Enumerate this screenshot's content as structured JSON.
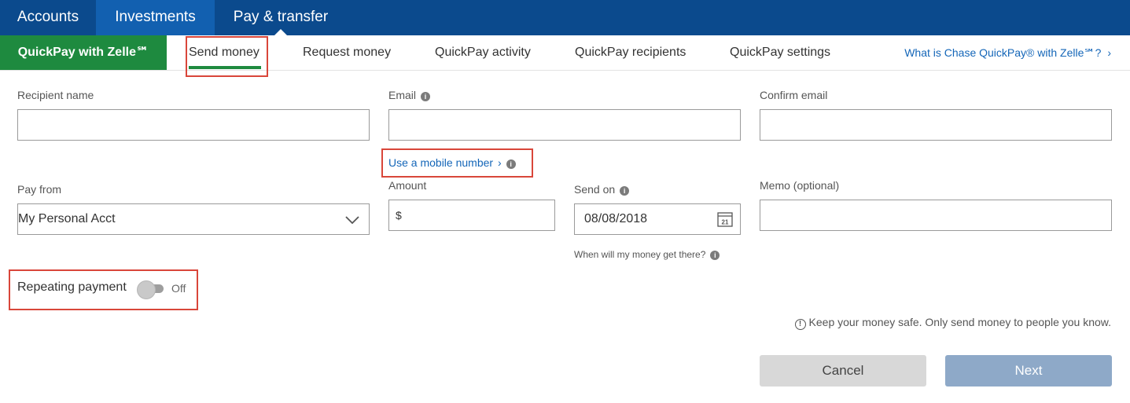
{
  "topnav": {
    "tabs": [
      {
        "label": "Accounts"
      },
      {
        "label": "Investments"
      },
      {
        "label": "Pay & transfer"
      }
    ]
  },
  "subnav": {
    "brand": "QuickPay with Zelle℠",
    "tabs": [
      {
        "label": "Send money"
      },
      {
        "label": "Request money"
      },
      {
        "label": "QuickPay activity"
      },
      {
        "label": "QuickPay recipients"
      },
      {
        "label": "QuickPay settings"
      }
    ],
    "help_link": "What is Chase QuickPay® with Zelle℠?"
  },
  "form": {
    "recipient_name": {
      "label": "Recipient name",
      "value": ""
    },
    "email": {
      "label": "Email",
      "value": ""
    },
    "confirm_email": {
      "label": "Confirm email",
      "value": ""
    },
    "mobile_link": "Use a mobile number",
    "pay_from": {
      "label": "Pay from",
      "value": "My Personal Acct"
    },
    "amount": {
      "label": "Amount",
      "prefix": "$",
      "value": ""
    },
    "send_on": {
      "label": "Send on",
      "value": "08/08/2018",
      "calendar_day": "21"
    },
    "delivery_help": "When will my money get there?",
    "memo": {
      "label": "Memo (optional)",
      "value": ""
    },
    "repeating": {
      "label": "Repeating payment",
      "state": "Off"
    }
  },
  "warning": "Keep your money safe. Only send money to people you know.",
  "buttons": {
    "cancel": "Cancel",
    "next": "Next"
  },
  "colors": {
    "topnav_bg": "#0b4a8d",
    "active_tab_bg": "#1260b0",
    "brand_green": "#1e8a3f",
    "link_blue": "#1466b8",
    "highlight_red": "#d9463a",
    "next_disabled": "#8ea9c8"
  }
}
